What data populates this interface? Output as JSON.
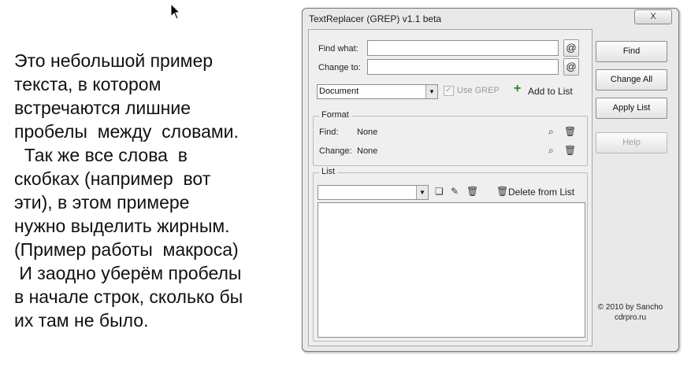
{
  "document": {
    "lines": [
      "Это небольшой пример",
      "текста, в котором",
      "встречаются лишние",
      "пробелы  между  словами.",
      "  Так же все слова  в",
      "скобках (например  вот",
      "эти), в этом примере",
      "нужно выделить жирным.",
      "(Пример работы  макроса)",
      " И заодно уберём пробелы",
      "в начале строк, сколько бы",
      "их там не было."
    ]
  },
  "window": {
    "title": "TextReplacer (GREP) v1.1 beta",
    "close_label": "X"
  },
  "search": {
    "find_label": "Find what:",
    "find_value": "",
    "change_label": "Change to:",
    "change_value": "",
    "at_symbol": "@"
  },
  "scope": {
    "selected": "Document",
    "use_grep_label": "Use GREP",
    "add_to_list_label": "Add to List"
  },
  "format": {
    "title": "Format",
    "find_label": "Find:",
    "find_value": "None",
    "change_label": "Change:",
    "change_value": "None"
  },
  "list": {
    "title": "List",
    "selected": "",
    "delete_label": "Delete from List",
    "items": []
  },
  "buttons": {
    "find": "Find",
    "change_all": "Change All",
    "apply_list": "Apply List",
    "help": "Help"
  },
  "credit": {
    "line1": "© 2010 by Sancho",
    "line2": "cdrpro.ru"
  },
  "colors": {
    "add_icon": "#1a8a1a",
    "window_bg": "#e9e9e9"
  }
}
